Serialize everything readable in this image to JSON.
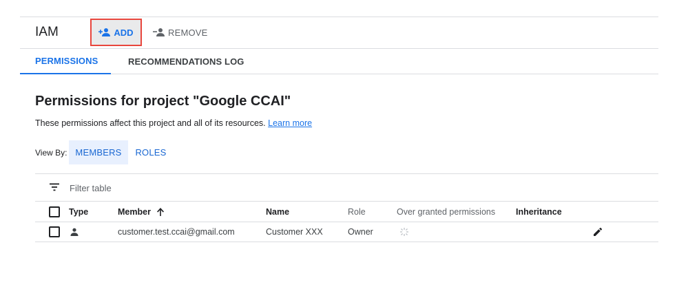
{
  "toolbar": {
    "title": "IAM",
    "add_label": "ADD",
    "remove_label": "REMOVE"
  },
  "tabs": [
    {
      "label": "PERMISSIONS",
      "active": true
    },
    {
      "label": "RECOMMENDATIONS LOG",
      "active": false
    }
  ],
  "main": {
    "title": "Permissions for project \"Google CCAI\"",
    "description": "These permissions affect this project and all of its resources.",
    "learn_more": "Learn more"
  },
  "view_by": {
    "label": "View By:",
    "options": [
      {
        "label": "MEMBERS",
        "selected": true
      },
      {
        "label": "ROLES",
        "selected": false
      }
    ]
  },
  "filter": {
    "placeholder": "Filter table",
    "icon": "filter-icon"
  },
  "table": {
    "columns": [
      "Type",
      "Member",
      "Name",
      "Role",
      "Over granted permissions",
      "Inheritance"
    ],
    "sort_column": "Member",
    "sort_direction": "ascending",
    "rows": [
      {
        "type_icon": "person-icon",
        "member": "customer.test.ccai@gmail.com",
        "name": "Customer XXX",
        "role": "Owner",
        "over_granted_icon": "insights-icon",
        "inheritance": "",
        "action_icon": "edit-icon"
      }
    ]
  },
  "colors": {
    "accent": "#1a73e8",
    "highlight_border": "#e8453c",
    "selected_bg": "#e8f0fe",
    "divider": "#dadce0"
  }
}
